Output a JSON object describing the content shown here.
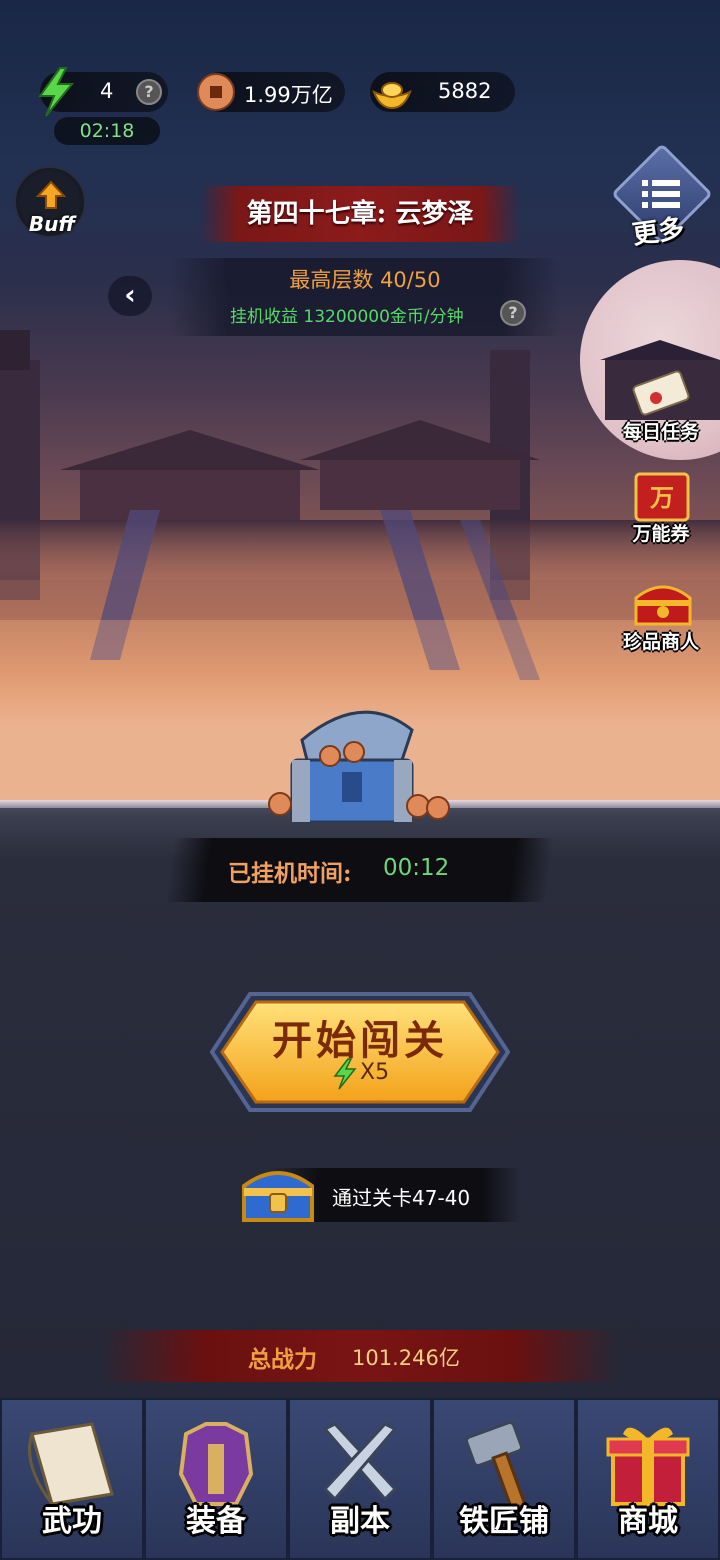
{
  "resources": {
    "energy": {
      "value": "4",
      "icon": "lightning-icon",
      "timer": "02:18"
    },
    "coins": {
      "value": "1.99万亿",
      "icon": "copper-coin-icon"
    },
    "gold": {
      "value": "5882",
      "icon": "gold-ingot-icon"
    }
  },
  "buff": {
    "label": "Buff"
  },
  "chapter": {
    "title": "第四十七章: 云梦泽"
  },
  "more": {
    "label": "更多"
  },
  "progress": {
    "max_floor": "最高层数 40/50",
    "idle_income": "挂机收益 13200000金币/分钟"
  },
  "side_menu": [
    {
      "label": "每日任务",
      "icon": "scroll-icon"
    },
    {
      "label": "万能券",
      "icon": "voucher-icon"
    },
    {
      "label": "珍品商人",
      "icon": "treasure-chest-icon"
    }
  ],
  "idle": {
    "label": "已挂机时间:",
    "time": "00:12"
  },
  "start_button": {
    "title": "开始闯关",
    "cost": "X5",
    "cost_icon": "lightning-icon"
  },
  "reward": {
    "text": "通过关卡47-40",
    "icon": "gold-chest-icon"
  },
  "power": {
    "label": "总战力",
    "value": "101.246亿"
  },
  "nav": [
    {
      "label": "武功",
      "icon": "scroll-book-icon"
    },
    {
      "label": "装备",
      "icon": "armor-icon"
    },
    {
      "label": "副本",
      "icon": "crossed-swords-icon"
    },
    {
      "label": "铁匠铺",
      "icon": "hammer-icon"
    },
    {
      "label": "商城",
      "icon": "gift-box-icon"
    }
  ],
  "colors": {
    "accent_orange": "#f0a040",
    "green": "#58d86a",
    "banner_red": "#8c1b1b",
    "nav_bg": "#2b3554"
  }
}
